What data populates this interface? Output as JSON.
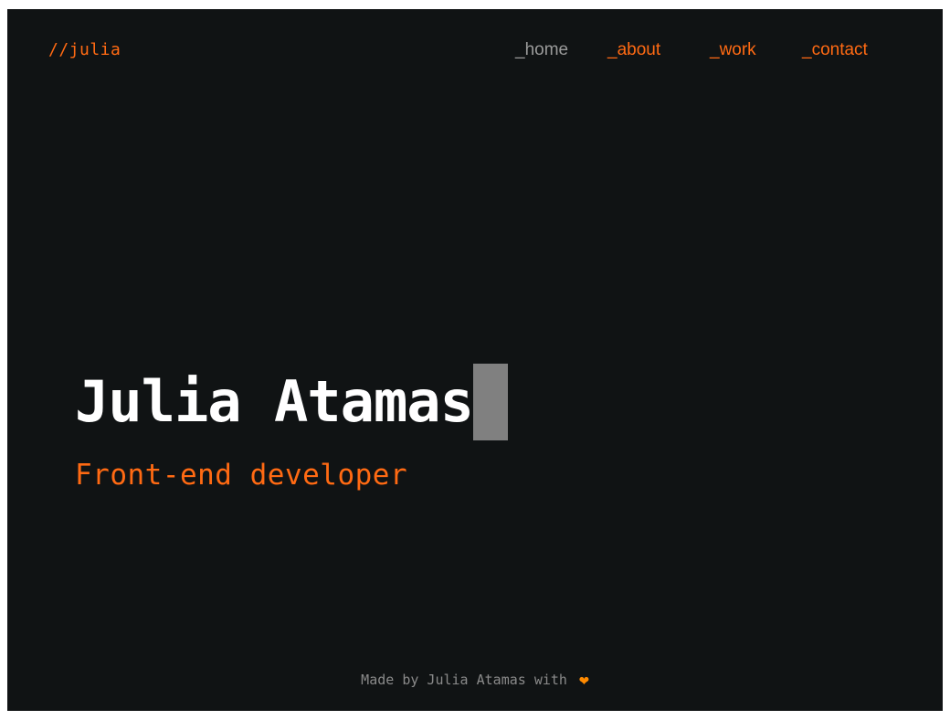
{
  "header": {
    "logo": "//julia",
    "nav": [
      {
        "label": "_home",
        "active": true
      },
      {
        "label": "_about",
        "active": false
      },
      {
        "label": "_work",
        "active": false
      },
      {
        "label": "_contact",
        "active": false
      }
    ]
  },
  "hero": {
    "name": "Julia Atamas",
    "role": "Front-end developer"
  },
  "footer": {
    "text": "Made by Julia Atamas with",
    "icon": "heart-icon"
  },
  "colors": {
    "background": "#101314",
    "accent": "#ff6a13",
    "nav_active": "#9a9a9a",
    "name": "#ffffff",
    "cursor": "#808080",
    "heart": "#ff8a00"
  }
}
